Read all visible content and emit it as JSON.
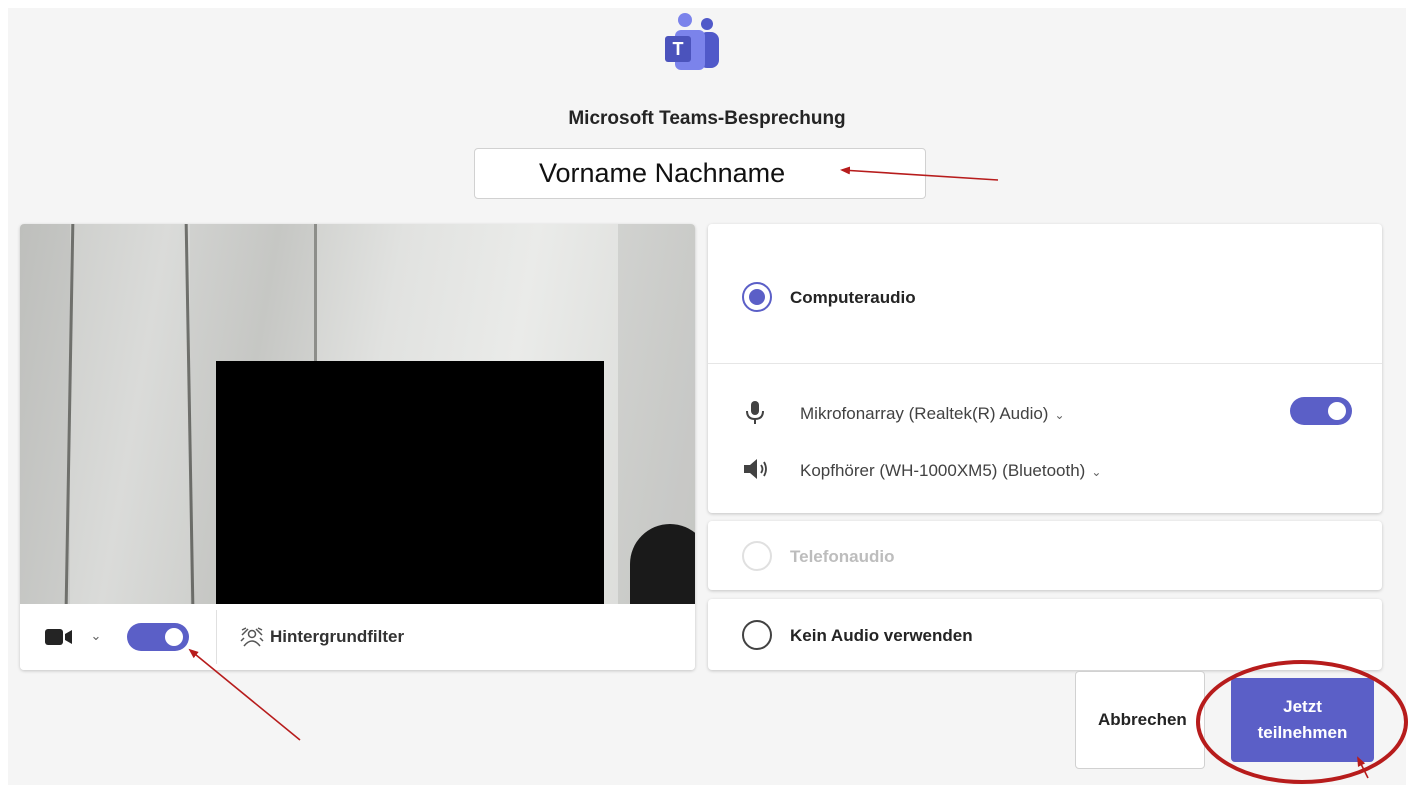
{
  "meeting": {
    "title": "Microsoft Teams-Besprechung",
    "name_input_value": "Vorname Nachname"
  },
  "video": {
    "camera_icon": "video-camera-icon",
    "camera_on": true,
    "background_filter_label": "Hintergrundfilter",
    "background_filter_icon": "background-blur-icon"
  },
  "audio": {
    "computer_audio_label": "Computeraudio",
    "computer_audio_selected": true,
    "microphone_label": "Mikrofonarray (Realtek(R) Audio)",
    "microphone_on": true,
    "speaker_label": "Kopfhörer (WH-1000XM5) (Bluetooth)",
    "phone_audio_label": "Telefonaudio",
    "phone_audio_disabled": true,
    "no_audio_label": "Kein Audio verwenden"
  },
  "actions": {
    "cancel_label": "Abbrechen",
    "join_label_line1": "Jetzt",
    "join_label_line2": "teilnehmen"
  },
  "colors": {
    "accent": "#5b5fc7",
    "annotation": "#b71c1c",
    "background": "#f5f5f5"
  }
}
